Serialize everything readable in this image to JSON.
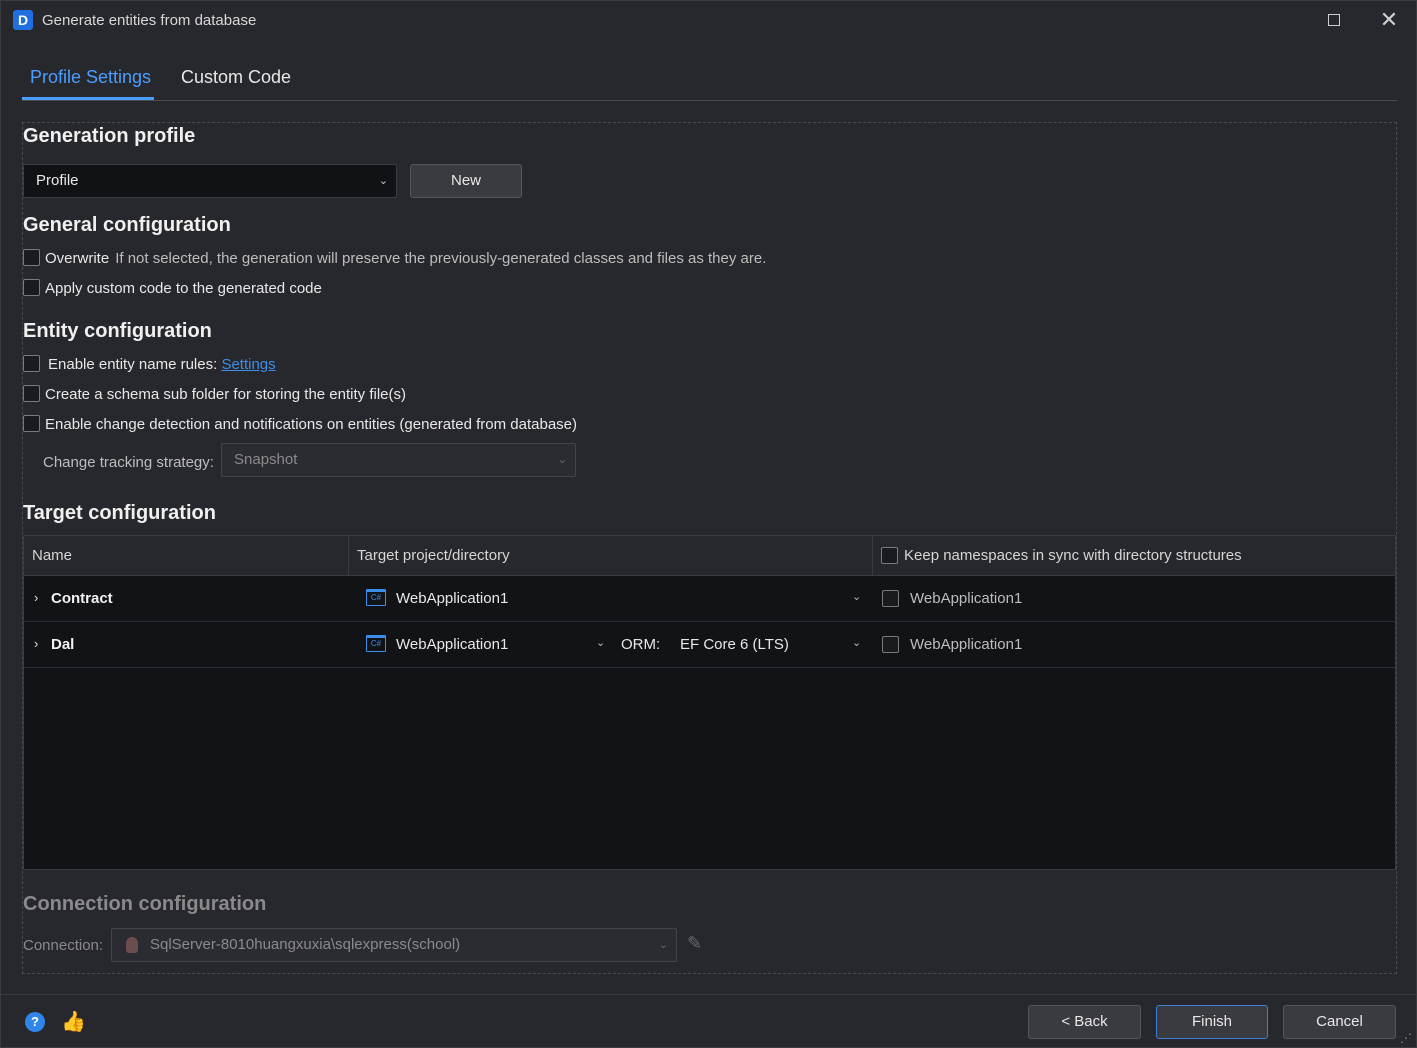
{
  "window": {
    "title": "Generate entities from database",
    "logo_letter": "D",
    "maximize_icon": "maximize-icon",
    "close_glyph": "✕"
  },
  "tabs": [
    {
      "label": "Profile Settings",
      "active": true
    },
    {
      "label": "Custom Code",
      "active": false
    }
  ],
  "generation_profile": {
    "heading": "Generation profile",
    "profile_value": "Profile",
    "new_button": "New"
  },
  "general_configuration": {
    "heading": "General configuration",
    "overwrite_label": "Overwrite",
    "overwrite_desc": "If not selected, the generation will preserve the previously-generated classes and files as they are.",
    "overwrite_checked": false,
    "apply_custom_code_label": "Apply custom code to the generated code",
    "apply_custom_code_checked": false
  },
  "entity_configuration": {
    "heading": "Entity configuration",
    "name_rules_label": "Enable entity name rules:",
    "name_rules_link": "Settings",
    "name_rules_checked": false,
    "schema_subfolder_label": "Create a schema sub folder for storing the entity file(s)",
    "schema_subfolder_checked": false,
    "change_detection_label": "Enable change detection and notifications on entities (generated from database)",
    "change_detection_checked": false,
    "tracking_strategy_label": "Change tracking strategy:",
    "tracking_strategy_value": "Snapshot"
  },
  "target_configuration": {
    "heading": "Target configuration",
    "columns": {
      "name": "Name",
      "target": "Target project/directory",
      "keep_namespaces": "Keep namespaces in sync with directory structures"
    },
    "keep_namespaces_checked": false,
    "rows": [
      {
        "name": "Contract",
        "project": "WebApplication1",
        "orm_label": "",
        "orm_value": "",
        "namespace": "WebApplication1",
        "namespace_checked": false
      },
      {
        "name": "Dal",
        "project": "WebApplication1",
        "orm_label": "ORM:",
        "orm_value": "EF Core 6 (LTS)",
        "namespace": "WebApplication1",
        "namespace_checked": false
      }
    ],
    "project_icon_text": "C#"
  },
  "connection_configuration": {
    "heading": "Connection configuration",
    "connection_label": "Connection:",
    "connection_value": "SqlServer-8010huangxuxia\\sqlexpress(school)"
  },
  "footer": {
    "back_button": "< Back",
    "finish_button": "Finish",
    "cancel_button": "Cancel",
    "help_glyph": "?",
    "thumb_glyph": "👍",
    "grip_glyph": "⋰"
  },
  "colors": {
    "accent": "#4a9eff",
    "link": "#3b8eea",
    "background": "#27282d",
    "grid_background": "#121317"
  }
}
